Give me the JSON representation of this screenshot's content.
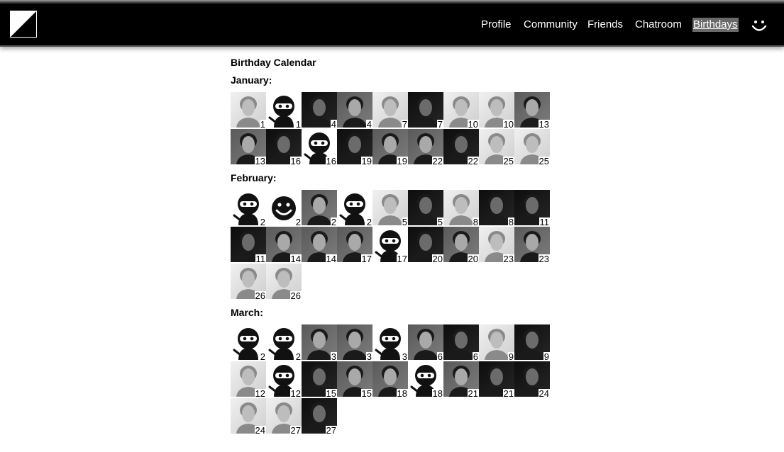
{
  "header": {
    "nav": [
      {
        "label": "Profile",
        "key": "profile"
      },
      {
        "label": "Community",
        "key": "community"
      },
      {
        "label": "Friends",
        "key": "friends"
      },
      {
        "label": "Chatroom",
        "key": "chatroom"
      },
      {
        "label": "Birthdays",
        "key": "birthdays",
        "active": true
      }
    ],
    "icons": {
      "logo": "diagonal-square-logo",
      "user": "smiley-icon"
    }
  },
  "page": {
    "title": "Birthday Calendar",
    "months": [
      {
        "label": "January:",
        "entries": [
          {
            "day": "1",
            "avatar": "photo",
            "tone": "light"
          },
          {
            "day": "1",
            "avatar": "ninja"
          },
          {
            "day": "4",
            "avatar": "photo",
            "tone": "dark"
          },
          {
            "day": "4",
            "avatar": "photo",
            "tone": "mid"
          },
          {
            "day": "7",
            "avatar": "photo",
            "tone": "light"
          },
          {
            "day": "7",
            "avatar": "photo",
            "tone": "dark"
          },
          {
            "day": "10",
            "avatar": "photo",
            "tone": "light"
          },
          {
            "day": "10",
            "avatar": "photo",
            "tone": "light"
          },
          {
            "day": "13",
            "avatar": "photo",
            "tone": "mid"
          },
          {
            "day": "13",
            "avatar": "photo",
            "tone": "mid"
          },
          {
            "day": "16",
            "avatar": "photo",
            "tone": "dark"
          },
          {
            "day": "16",
            "avatar": "ninja"
          },
          {
            "day": "19",
            "avatar": "photo",
            "tone": "dark"
          },
          {
            "day": "19",
            "avatar": "photo",
            "tone": "mid"
          },
          {
            "day": "22",
            "avatar": "photo",
            "tone": "mid"
          },
          {
            "day": "22",
            "avatar": "photo",
            "tone": "dark"
          },
          {
            "day": "25",
            "avatar": "photo",
            "tone": "light"
          },
          {
            "day": "25",
            "avatar": "photo",
            "tone": "light"
          }
        ]
      },
      {
        "label": "February:",
        "entries": [
          {
            "day": "2",
            "avatar": "ninja"
          },
          {
            "day": "2",
            "avatar": "smiley"
          },
          {
            "day": "2",
            "avatar": "photo",
            "tone": "mid"
          },
          {
            "day": "2",
            "avatar": "ninja"
          },
          {
            "day": "5",
            "avatar": "photo",
            "tone": "light"
          },
          {
            "day": "5",
            "avatar": "photo",
            "tone": "dark"
          },
          {
            "day": "8",
            "avatar": "photo",
            "tone": "light"
          },
          {
            "day": "8",
            "avatar": "photo",
            "tone": "dark"
          },
          {
            "day": "11",
            "avatar": "photo",
            "tone": "dark"
          },
          {
            "day": "11",
            "avatar": "photo",
            "tone": "dark"
          },
          {
            "day": "14",
            "avatar": "photo",
            "tone": "mid"
          },
          {
            "day": "14",
            "avatar": "photo",
            "tone": "mid"
          },
          {
            "day": "17",
            "avatar": "photo",
            "tone": "mid"
          },
          {
            "day": "17",
            "avatar": "ninja"
          },
          {
            "day": "20",
            "avatar": "photo",
            "tone": "dark"
          },
          {
            "day": "20",
            "avatar": "photo",
            "tone": "mid"
          },
          {
            "day": "23",
            "avatar": "photo",
            "tone": "light"
          },
          {
            "day": "23",
            "avatar": "photo",
            "tone": "mid"
          },
          {
            "day": "26",
            "avatar": "photo",
            "tone": "light"
          },
          {
            "day": "26",
            "avatar": "photo",
            "tone": "light"
          }
        ]
      },
      {
        "label": "March:",
        "entries": [
          {
            "day": "2",
            "avatar": "ninja"
          },
          {
            "day": "2",
            "avatar": "ninja"
          },
          {
            "day": "3",
            "avatar": "photo",
            "tone": "mid"
          },
          {
            "day": "3",
            "avatar": "photo",
            "tone": "mid"
          },
          {
            "day": "3",
            "avatar": "ninja"
          },
          {
            "day": "6",
            "avatar": "photo",
            "tone": "mid"
          },
          {
            "day": "6",
            "avatar": "photo",
            "tone": "dark"
          },
          {
            "day": "9",
            "avatar": "photo",
            "tone": "light"
          },
          {
            "day": "9",
            "avatar": "photo",
            "tone": "dark"
          },
          {
            "day": "12",
            "avatar": "photo",
            "tone": "light"
          },
          {
            "day": "12",
            "avatar": "ninja"
          },
          {
            "day": "15",
            "avatar": "photo",
            "tone": "dark"
          },
          {
            "day": "15",
            "avatar": "photo",
            "tone": "mid"
          },
          {
            "day": "18",
            "avatar": "photo",
            "tone": "mid"
          },
          {
            "day": "18",
            "avatar": "ninja"
          },
          {
            "day": "21",
            "avatar": "photo",
            "tone": "mid"
          },
          {
            "day": "21",
            "avatar": "photo",
            "tone": "dark"
          },
          {
            "day": "24",
            "avatar": "photo",
            "tone": "dark"
          },
          {
            "day": "24",
            "avatar": "photo",
            "tone": "light"
          },
          {
            "day": "27",
            "avatar": "photo",
            "tone": "light"
          },
          {
            "day": "27",
            "avatar": "photo",
            "tone": "dark"
          }
        ]
      }
    ]
  },
  "colors": {
    "header_bg": "#000000",
    "active_nav_bg": "#6a6a6a",
    "text": "#000000",
    "page_bg": "#ffffff"
  }
}
